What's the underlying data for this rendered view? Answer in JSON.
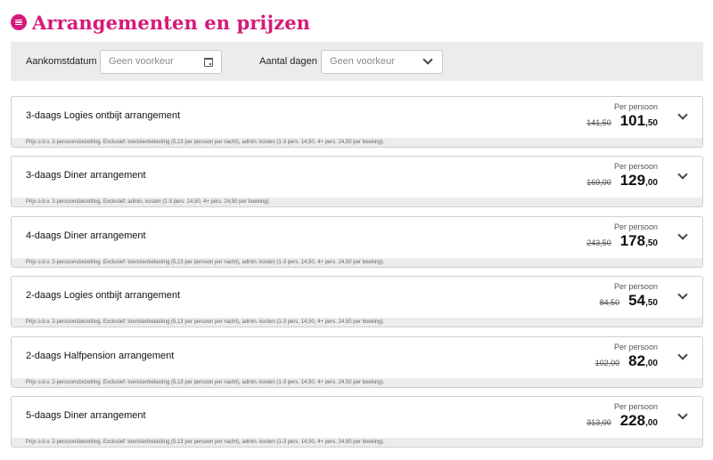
{
  "page": {
    "title": "Arrangementen en prijzen",
    "menu_icon": "menu-icon",
    "accent_color": "#d6197a"
  },
  "filters": {
    "arrival_label": "Aankomstdatum",
    "arrival_placeholder": "Geen voorkeur",
    "arrival_icon": "calendar-icon",
    "days_label": "Aantal dagen",
    "days_value": "Geen voorkeur",
    "days_icon": "chevron-down-icon"
  },
  "packages": [
    {
      "name": "3-daags Logies ontbijt arrangement",
      "per_person_label": "Per persoon",
      "old_price": "141,50",
      "price_main": "101",
      "price_decimals": ",50",
      "note": "Prijs o.b.v. 2-persoonsbezetting. Exclusief: toeristenbelasting (5,13 per persoon per nacht), admin. kosten (1-3 pers. 14,50, 4+ pers. 24,50 per boeking)."
    },
    {
      "name": "3-daags Diner arrangement",
      "per_person_label": "Per persoon",
      "old_price": "169,00",
      "price_main": "129",
      "price_decimals": ",00",
      "note": "Prijs o.b.v. 2-persoonsbezetting. Exclusief: admin. kosten (1-3 pers. 14,50, 4+ pers. 24,50 per boeking)."
    },
    {
      "name": "4-daags Diner arrangement",
      "per_person_label": "Per persoon",
      "old_price": "243,50",
      "price_main": "178",
      "price_decimals": ",50",
      "note": "Prijs o.b.v. 2-persoonsbezetting. Exclusief: toeristenbelasting (5,13 per persoon per nacht), admin. kosten (1-3 pers. 14,50, 4+ pers. 24,50 per boeking)."
    },
    {
      "name": "2-daags Logies ontbijt arrangement",
      "per_person_label": "Per persoon",
      "old_price": "84,50",
      "price_main": "54",
      "price_decimals": ",50",
      "note": "Prijs o.b.v. 2-persoonsbezetting. Exclusief: toeristenbelasting (5,13 per persoon per nacht), admin. kosten (1-3 pers. 14,50, 4+ pers. 24,50 per boeking)."
    },
    {
      "name": "2-daags Halfpension arrangement",
      "per_person_label": "Per persoon",
      "old_price": "102,00",
      "price_main": "82",
      "price_decimals": ",00",
      "note": "Prijs o.b.v. 2-persoonsbezetting. Exclusief: toeristenbelasting (5,13 per persoon per nacht), admin. kosten (1-3 pers. 14,50, 4+ pers. 24,50 per boeking)."
    },
    {
      "name": "5-daags Diner arrangement",
      "per_person_label": "Per persoon",
      "old_price": "313,00",
      "price_main": "228",
      "price_decimals": ",00",
      "note": "Prijs o.b.v. 2-persoonsbezetting. Exclusief: toeristenbelasting (5,13 per persoon per nacht), admin. kosten (1-3 pers. 14,50, 4+ pers. 24,50 per boeking)."
    }
  ]
}
